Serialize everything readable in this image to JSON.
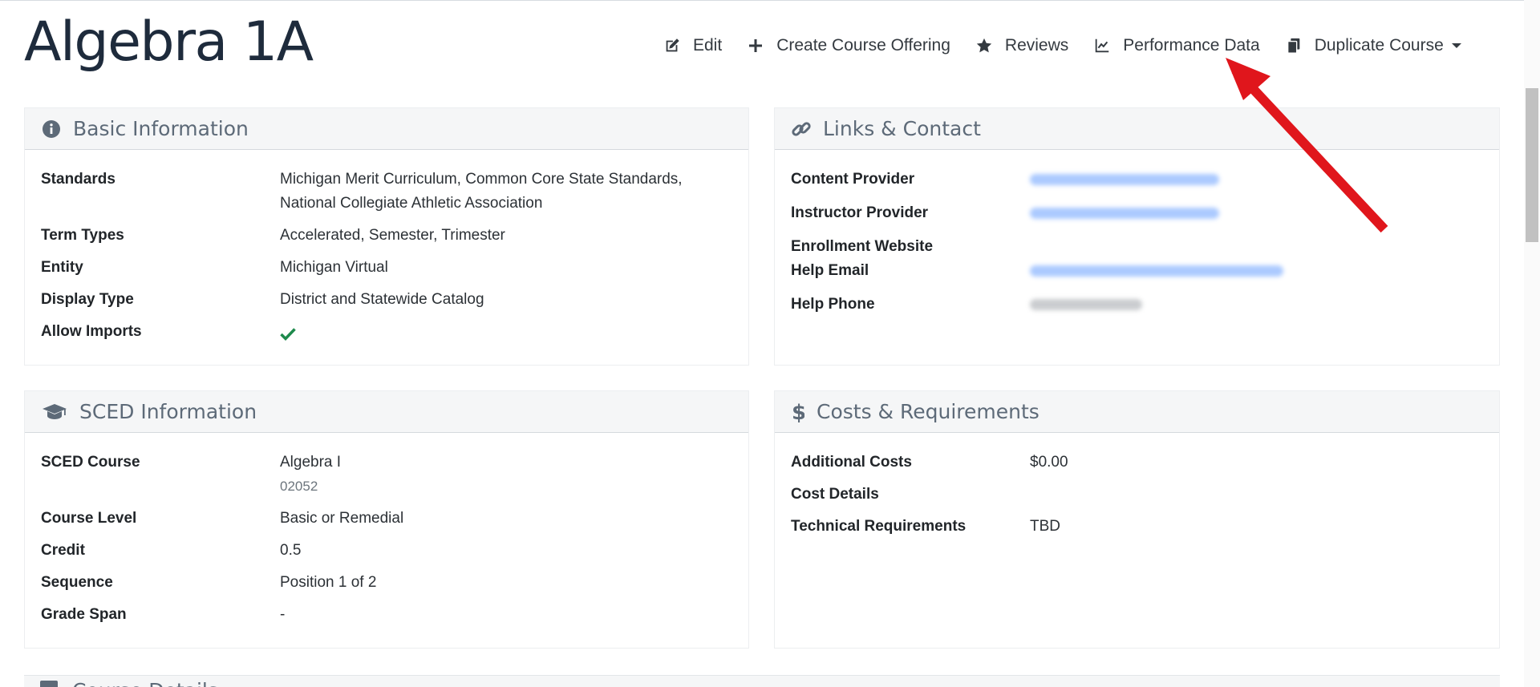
{
  "page": {
    "title": "Algebra 1A"
  },
  "actions": [
    {
      "label": "Edit",
      "icon": "edit-icon"
    },
    {
      "label": "Create Course Offering",
      "icon": "plus-icon"
    },
    {
      "label": "Reviews",
      "icon": "star-icon"
    },
    {
      "label": "Performance Data",
      "icon": "chart-line-icon"
    },
    {
      "label": "Duplicate Course",
      "icon": "copy-icon",
      "dropdown": true
    }
  ],
  "basic_info": {
    "title": "Basic Information",
    "icon": "info-circle-icon",
    "rows": [
      {
        "label": "Standards",
        "value": "Michigan Merit Curriculum, Common Core State Standards, National Collegiate Athletic Association"
      },
      {
        "label": "Term Types",
        "value": "Accelerated, Semester, Trimester"
      },
      {
        "label": "Entity",
        "value": "Michigan Virtual"
      },
      {
        "label": "Display Type",
        "value": "District and Statewide Catalog"
      },
      {
        "label": "Allow Imports",
        "value": "",
        "icon": "check-icon"
      }
    ]
  },
  "links_contact": {
    "title": "Links & Contact",
    "icon": "link-icon",
    "rows": [
      {
        "label": "Content Provider"
      },
      {
        "label": "Instructor Provider"
      },
      {
        "label": "Enrollment Website"
      },
      {
        "label": "Help Email"
      },
      {
        "label": "Help Phone"
      }
    ]
  },
  "sced_info": {
    "title": "SCED Information",
    "icon": "graduation-cap-icon",
    "rows": [
      {
        "label": "SCED Course",
        "value": "Algebra I",
        "sub": "02052"
      },
      {
        "label": "Course Level",
        "value": "Basic or Remedial"
      },
      {
        "label": "Credit",
        "value": "0.5"
      },
      {
        "label": "Sequence",
        "value": "Position 1 of 2"
      },
      {
        "label": "Grade Span",
        "value": "-"
      }
    ]
  },
  "costs": {
    "title": "Costs & Requirements",
    "icon": "dollar-icon",
    "rows": [
      {
        "label": "Additional Costs",
        "value": "$0.00"
      },
      {
        "label": "Cost Details",
        "value": ""
      },
      {
        "label": "Technical Requirements",
        "value": "TBD"
      }
    ]
  },
  "next_section": {
    "title": "Course Details"
  },
  "colors": {
    "accent_arrow": "#e0161c",
    "check": "#1e8a4c",
    "header_bg": "#f5f6f7",
    "title": "#1e2b3c"
  }
}
